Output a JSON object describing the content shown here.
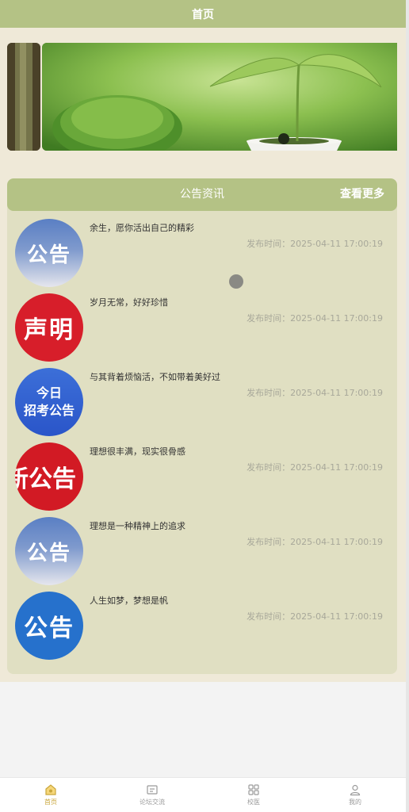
{
  "header": {
    "title": "首页"
  },
  "notices": {
    "title": "公告资讯",
    "more_label": "查看更多",
    "time_label": "发布时间：",
    "items": [
      {
        "text": "余生，愿你活出自己的精彩",
        "time": "2025-04-11 17:00:19",
        "thumb": "公告"
      },
      {
        "text": "岁月无常，好好珍惜",
        "time": "2025-04-11 17:00:19",
        "thumb": "声明"
      },
      {
        "text": "与其背着烦恼活，不如带着美好过",
        "time": "2025-04-11 17:00:19",
        "thumb_line1": "今日",
        "thumb_line2": "招考公告"
      },
      {
        "text": "理想很丰满，现实很骨感",
        "time": "2025-04-11 17:00:19",
        "thumb": "新公告"
      },
      {
        "text": "理想是一种精神上的追求",
        "time": "2025-04-11 17:00:19",
        "thumb": "公告"
      },
      {
        "text": "人生如梦，梦想是帆",
        "time": "2025-04-11 17:00:19",
        "thumb": "公告"
      }
    ]
  },
  "tabbar": {
    "items": [
      {
        "label": "首页",
        "icon": "home-icon",
        "active": true
      },
      {
        "label": "论坛交流",
        "icon": "forum-icon"
      },
      {
        "label": "校医",
        "icon": "grid-icon"
      },
      {
        "label": "我的",
        "icon": "user-icon"
      }
    ]
  },
  "colors": {
    "header": "#b4c285",
    "panel": "#e0dfc2",
    "page": "#efe9d8",
    "active_tab": "#c9a63b"
  }
}
